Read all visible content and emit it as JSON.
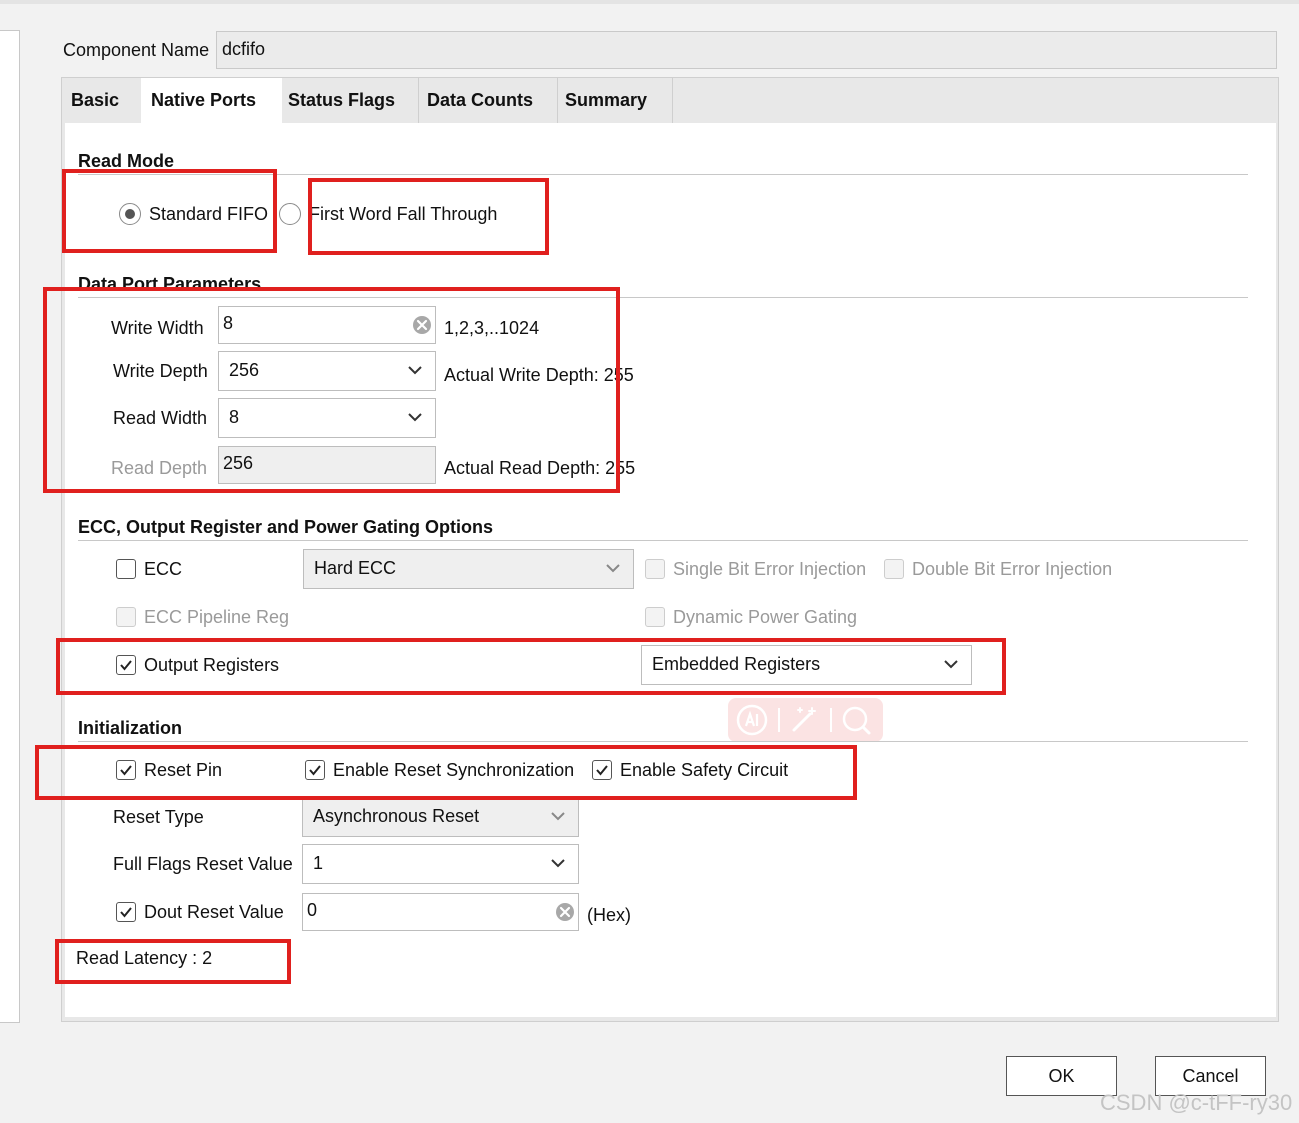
{
  "component": {
    "label": "Component Name",
    "value": "dcfifo"
  },
  "tabs": [
    {
      "label": "Basic"
    },
    {
      "label": "Native Ports"
    },
    {
      "label": "Status Flags"
    },
    {
      "label": "Data Counts"
    },
    {
      "label": "Summary"
    }
  ],
  "read_mode": {
    "title": "Read Mode",
    "standard": "Standard FIFO",
    "fwft": "First Word Fall Through"
  },
  "data_port": {
    "title": "Data Port Parameters",
    "write_width": {
      "label": "Write Width",
      "value": "8",
      "hint": "1,2,3,..1024"
    },
    "write_depth": {
      "label": "Write Depth",
      "value": "256",
      "note": "Actual Write Depth: 255"
    },
    "read_width": {
      "label": "Read Width",
      "value": "8"
    },
    "read_depth": {
      "label": "Read Depth",
      "value": "256",
      "note": "Actual Read Depth: 255"
    }
  },
  "ecc": {
    "title": "ECC, Output Register and Power Gating Options",
    "ecc_label": "ECC",
    "ecc_type": "Hard ECC",
    "single_bit": "Single Bit Error Injection",
    "double_bit": "Double Bit Error Injection",
    "pipeline": "ECC Pipeline Reg",
    "power_gating": "Dynamic Power Gating",
    "output_registers": "Output Registers",
    "output_type": "Embedded Registers"
  },
  "init": {
    "title": "Initialization",
    "reset_pin": "Reset Pin",
    "reset_sync": "Enable Reset Synchronization",
    "safety": "Enable Safety Circuit",
    "reset_type_label": "Reset Type",
    "reset_type_value": "Asynchronous Reset",
    "full_flags_label": "Full Flags Reset Value",
    "full_flags_value": "1",
    "dout_label": "Dout Reset Value",
    "dout_value": "0",
    "dout_unit": "(Hex)"
  },
  "read_latency": "Read Latency : 2",
  "buttons": {
    "ok": "OK",
    "cancel": "Cancel"
  },
  "watermark": "CSDN @c-tFF-ry30",
  "colors": {
    "highlight": "#e0201e"
  }
}
